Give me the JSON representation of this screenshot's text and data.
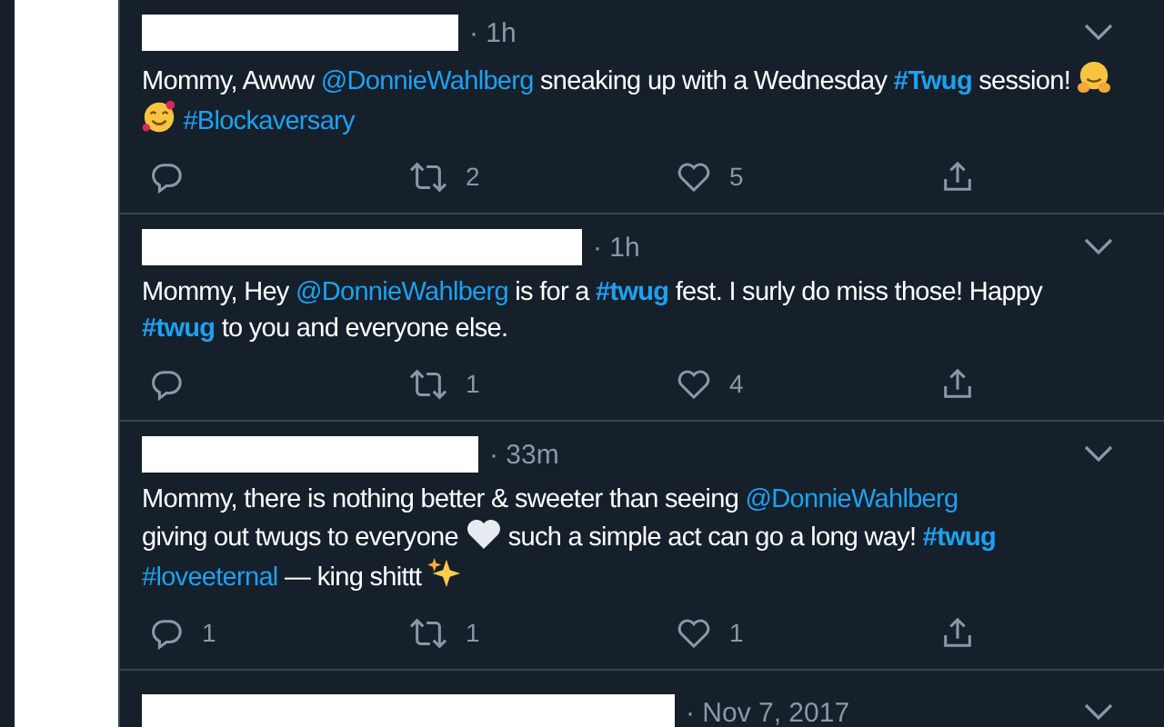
{
  "tweets": [
    {
      "time": "· 1h",
      "body": [
        {
          "kind": "text",
          "text": "Mommy, Awww "
        },
        {
          "kind": "mention",
          "text": "@DonnieWahlberg"
        },
        {
          "kind": "text",
          "text": " sneaking up with a Wednesday "
        },
        {
          "kind": "hashtag",
          "text": "#Twug",
          "bold": true
        },
        {
          "kind": "text",
          "text": " session!"
        },
        {
          "kind": "hug"
        },
        {
          "kind": "smiling-hearts"
        },
        {
          "kind": "hashtag",
          "text": "#Blockaversary",
          "bold": false
        }
      ],
      "retweets": "2",
      "likes": "5"
    },
    {
      "time": "· 1h",
      "body": [
        {
          "kind": "text",
          "text": "Mommy, Hey "
        },
        {
          "kind": "mention",
          "text": "@DonnieWahlberg"
        },
        {
          "kind": "text",
          "text": " is for a "
        },
        {
          "kind": "hashtag",
          "text": "#twug",
          "bold": true
        },
        {
          "kind": "text",
          "text": " fest. I surly do miss those!"
        },
        {
          "kind": "text",
          "text": "Happy"
        },
        {
          "kind": "hashtag",
          "text": "#twug",
          "bold": true
        },
        {
          "kind": "text",
          "text": " to you and everyone else."
        }
      ],
      "retweets": "1",
      "likes": "4"
    },
    {
      "time": "· 33m",
      "body": [
        {
          "kind": "text",
          "text": "Mommy, there is nothing better & sweeter than seeing "
        },
        {
          "kind": "mention",
          "text": "@DonnieWahlberg"
        },
        {
          "kind": "text",
          "text": " giving out twugs to everyone"
        },
        {
          "kind": "white-heart"
        },
        {
          "kind": "text",
          "text": "such a simple act can go a long way!"
        },
        {
          "kind": "hashtag",
          "text": "#twug",
          "bold": true
        },
        {
          "kind": "hashtag",
          "text": "#loveeternal",
          "bold": false
        },
        {
          "kind": "text",
          "text": " — king shittt"
        },
        {
          "kind": "sparkles"
        }
      ],
      "replies": "1",
      "retweets": "1",
      "likes": "1"
    },
    {
      "time": "· Nov 7, 2017"
    }
  ]
}
